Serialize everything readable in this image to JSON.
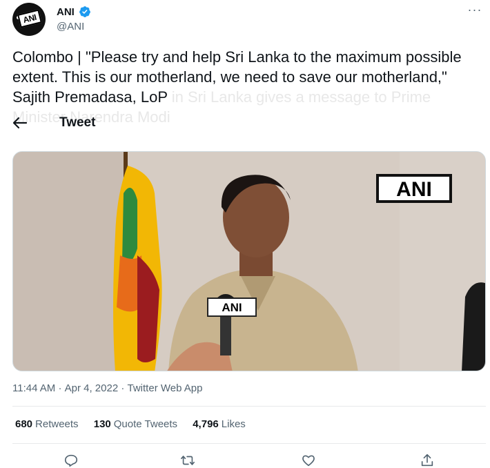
{
  "header": {
    "display_name": "ANI",
    "handle": "@ANI",
    "more_icon": "more-dots-icon",
    "verified_color": "#1d9bf0",
    "avatar_logo_text": "ANI"
  },
  "tweet": {
    "text_visible": "Colombo | \"Please try and help Sri Lanka to the maximum possible extent. This is our motherland, we need to save our motherland,\" Sajith Premadasa, LoP",
    "text_faded": "in Sri Lanka gives a message to Prime Minister Narendra Modi"
  },
  "nav": {
    "title": "Tweet",
    "back_icon": "back-arrow-icon"
  },
  "media": {
    "watermark": "ANI",
    "mic_label": "ANI"
  },
  "meta": {
    "time": "11:44 AM",
    "separator": "·",
    "date": "Apr 4, 2022",
    "source": "Twitter Web App"
  },
  "stats": {
    "retweets_count": "680",
    "retweets_label": "Retweets",
    "quotes_count": "130",
    "quotes_label": "Quote Tweets",
    "likes_count": "4,796",
    "likes_label": "Likes"
  },
  "actions": [
    "reply-icon",
    "retweet-icon",
    "like-icon",
    "share-icon"
  ],
  "colors": {
    "text": "#0f1419",
    "secondary": "#536471",
    "accent": "#1d9bf0"
  }
}
